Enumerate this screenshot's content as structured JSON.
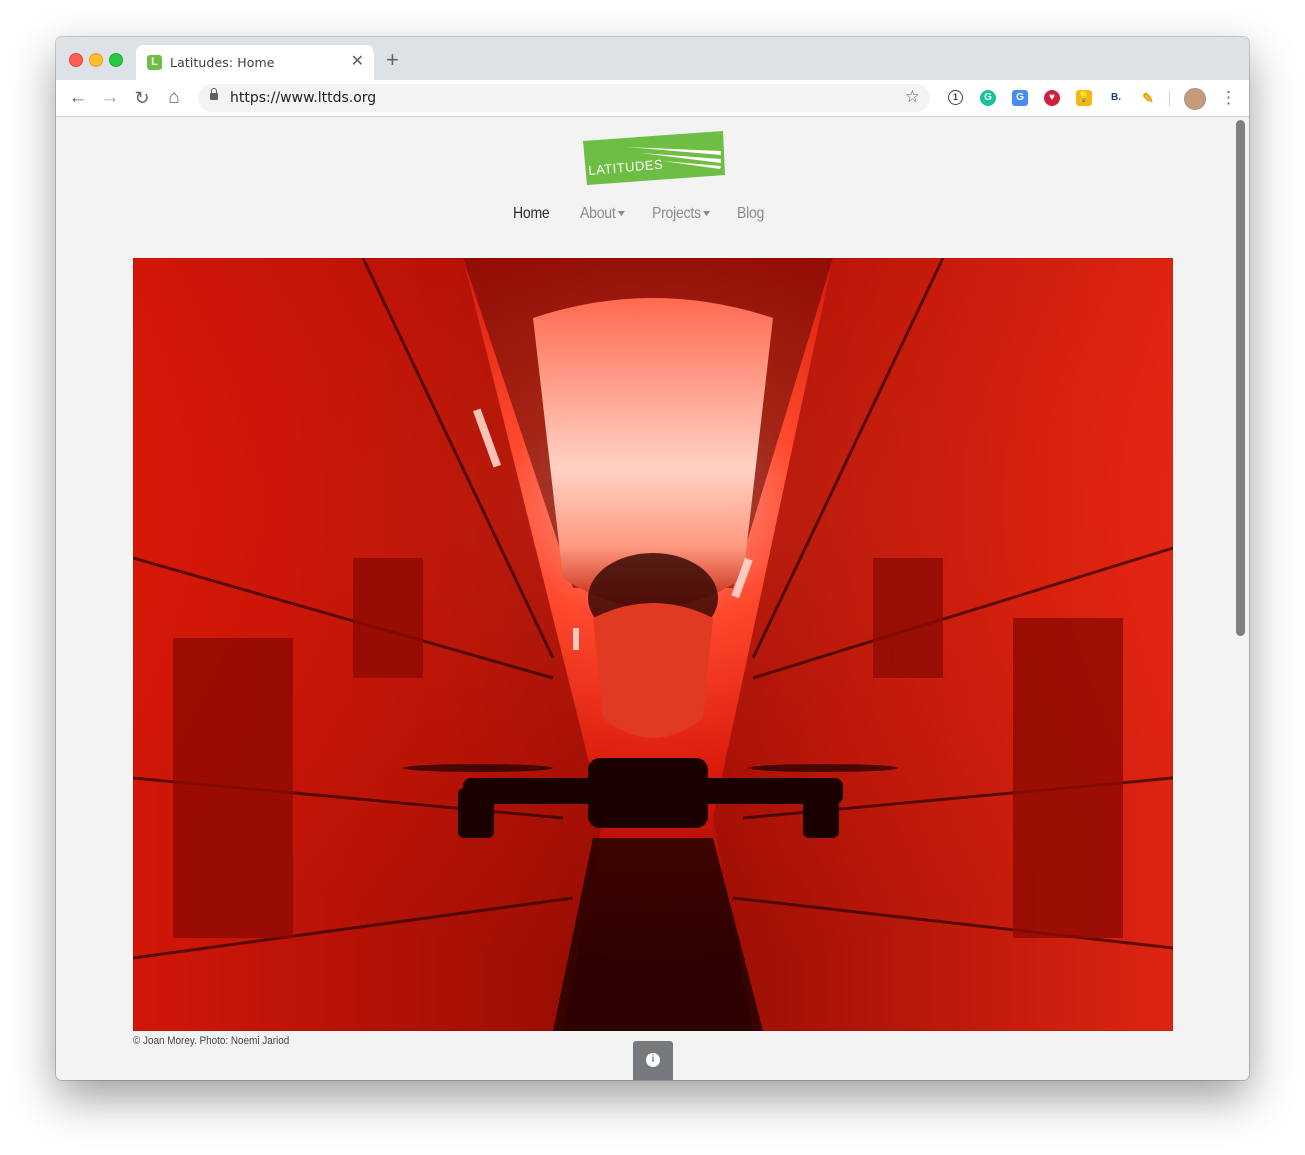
{
  "browser": {
    "tab": {
      "title": "Latitudes: Home",
      "favicon_letter": "L"
    },
    "url": "https://www.lttds.org",
    "colors": {
      "tabstrip": "#dee1e6",
      "toolbar": "#ffffff"
    }
  },
  "site": {
    "logo_text": "LATITUDES",
    "brand_color": "#6fbe44",
    "nav": [
      {
        "label": "Home",
        "active": true
      },
      {
        "label": "About",
        "dropdown": true
      },
      {
        "label": "Projects",
        "dropdown": true
      },
      {
        "label": "Blog"
      }
    ],
    "hero": {
      "caption": "© Joan Morey. Photo: Noemi Jariod"
    }
  }
}
